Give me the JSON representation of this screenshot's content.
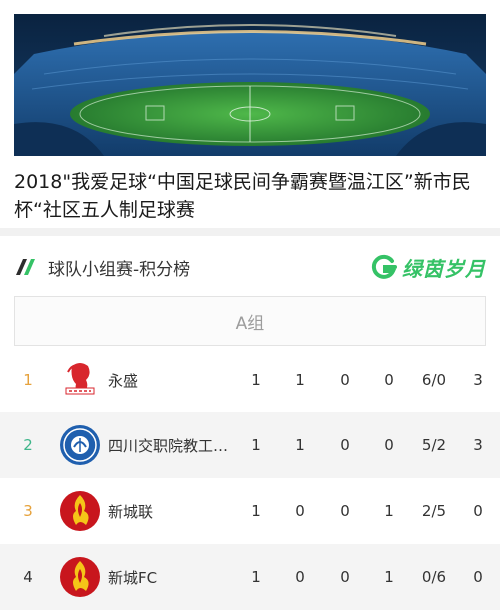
{
  "colors": {
    "brand_green": "#35c266",
    "rank_gold": "#e6a23c",
    "rank_green": "#3fb58a",
    "rank_default": "#333333"
  },
  "banner": {
    "image": "football-stadium-image"
  },
  "title": "2018\"我爱足球“中国足球民间争霸赛暨温江区”新市民杯“社区五人制足球赛",
  "section": {
    "icon": "stripes-icon",
    "title": "球队小组赛-积分榜",
    "brand_icon": "g-logo-icon",
    "brand_text": "绿茵岁月"
  },
  "group": {
    "label": "A组"
  },
  "standings": [
    {
      "rank": "1",
      "rank_color": "#e6a23c",
      "team": "永盛",
      "logo": "yongsheng-logo",
      "s1": "1",
      "s2": "1",
      "s3": "0",
      "s4": "0",
      "s5": "6/0",
      "s6": "3"
    },
    {
      "rank": "2",
      "rank_color": "#3fb58a",
      "team": "四川交职院教工…",
      "logo": "school-logo",
      "s1": "1",
      "s2": "1",
      "s3": "0",
      "s4": "0",
      "s5": "5/2",
      "s6": "3"
    },
    {
      "rank": "3",
      "rank_color": "#e6a23c",
      "team": "新城联",
      "logo": "xinchenglian-logo",
      "s1": "1",
      "s2": "0",
      "s3": "0",
      "s4": "1",
      "s5": "2/5",
      "s6": "0"
    },
    {
      "rank": "4",
      "rank_color": "#333333",
      "team": "新城FC",
      "logo": "xinchengfc-logo",
      "s1": "1",
      "s2": "0",
      "s3": "0",
      "s4": "1",
      "s5": "0/6",
      "s6": "0"
    }
  ]
}
